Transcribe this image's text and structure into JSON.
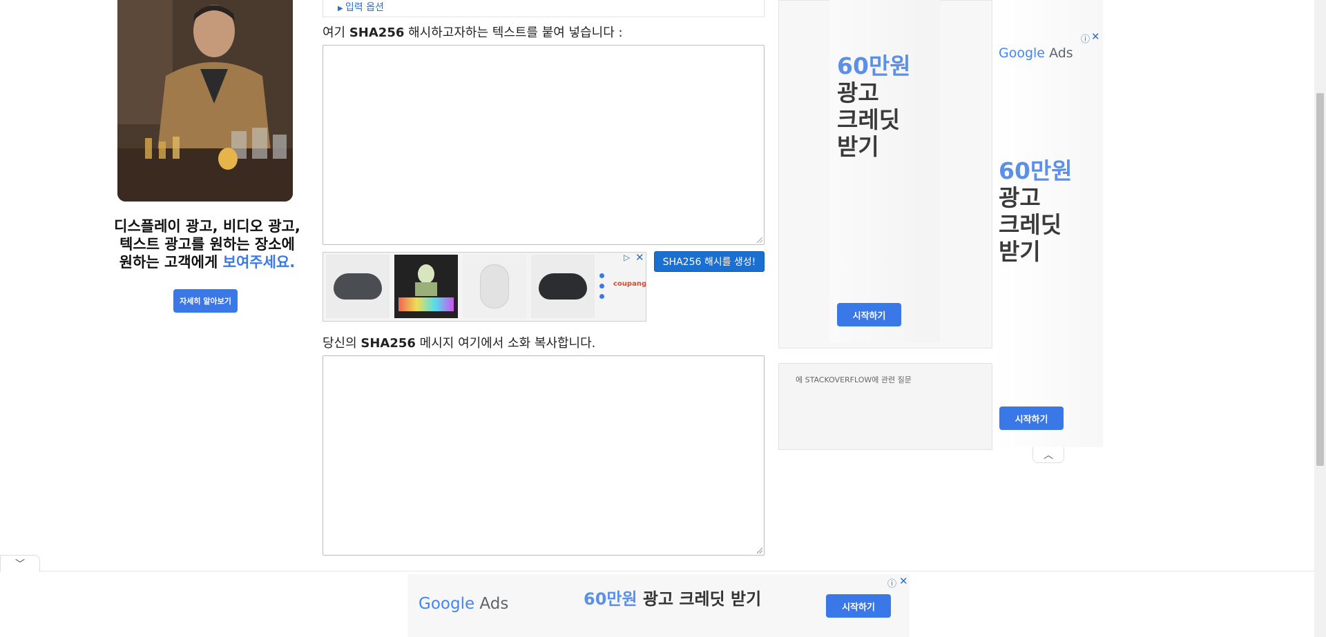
{
  "left_ad": {
    "headline_line1": "디스플레이 광고, 비디오 광고,",
    "headline_line2": "텍스트 광고를 원하는 장소에",
    "headline_line3_prefix": "원하는 고객에게 ",
    "headline_line3_highlight": "보여주세요.",
    "button_label": "자세히 알아보기"
  },
  "main": {
    "input_options_label": "입력 옵션",
    "input_label_prefix": "여기 ",
    "input_label_bold": "SHA256",
    "input_label_suffix": " 해시하고자하는 텍스트를 붙여 넣습니다 :",
    "input_value": "",
    "generate_button": "SHA256 해시를 생성!",
    "output_label_prefix": "당신의 ",
    "output_label_bold": "SHA256",
    "output_label_suffix": " 메시지 여기에서 소화 복사합니다.",
    "output_value": ""
  },
  "product_ad": {
    "brand": "coupang",
    "choices_icon": "ad-choices-icon",
    "close_icon": "close-icon"
  },
  "right_ad_1": {
    "amount": "60만원",
    "line2": "광고",
    "line3": "크레딧",
    "line4": "받기",
    "button_label": "시작하기"
  },
  "stackoverflow_box": {
    "label": "에 STACKOVERFLOW에 관련 질문"
  },
  "right_ad_2": {
    "logo_google": "Google",
    "logo_ads": "Ads",
    "amount": "60만원",
    "line2": "광고",
    "line3": "크레딧",
    "line4": "받기",
    "button_label": "시작하기",
    "info_icon": "ⓘ",
    "close_icon": "✕"
  },
  "bottom_ad": {
    "logo_google": "Google",
    "logo_ads": "Ads",
    "amount": "60만원",
    "credit_text": " 광고 크레딧 받기",
    "button_label": "시작하기",
    "info_icon": "ⓘ",
    "close_icon": "✕"
  },
  "colors": {
    "accent_blue": "#3b78e7",
    "button_blue": "#1a6fd1",
    "highlight_blue": "#5b8fe8"
  }
}
